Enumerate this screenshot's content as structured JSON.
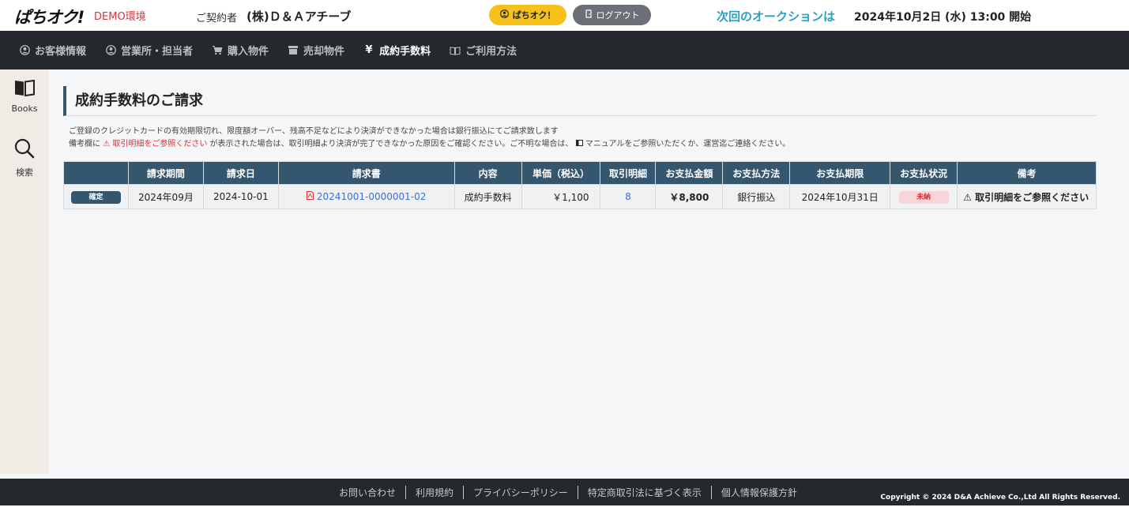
{
  "header": {
    "logo": "ぱちオク!",
    "environment": "DEMO環境",
    "contract_label": "ご契約者",
    "contract_name": "(株)Ｄ＆Ａアチーブ",
    "pachi_button": "ぱちオク！",
    "logout_button": "ログアウト",
    "next_auction_label": "次回のオークションは",
    "next_auction_date": "2024年10月2日 (水) 13:00 開始"
  },
  "nav": {
    "items": [
      {
        "label": "お客様情報",
        "icon": "user-circle-icon"
      },
      {
        "label": "営業所・担当者",
        "icon": "user-circle-icon"
      },
      {
        "label": "購入物件",
        "icon": "cart-icon"
      },
      {
        "label": "売却物件",
        "icon": "box-icon"
      },
      {
        "label": "成約手数料",
        "icon": "yen-icon"
      },
      {
        "label": "ご利用方法",
        "icon": "book-icon"
      }
    ]
  },
  "sidebar": {
    "books_label": "Books",
    "search_label": "検索"
  },
  "main": {
    "title": "成約手数料のご請求",
    "note1": "ご登録のクレジットカードの有効期限切れ、限度額オーバー、残高不足などにより決済ができなかった場合は銀行振込にてご請求致します",
    "note2_prefix": "備考欄に",
    "note2_warning": "取引明細をご参照ください",
    "note2_middle": "が表示された場合は、取引明細より決済が完了できなかった原因をご確認ください。ご不明な場合は、",
    "note2_suffix": "マニュアルをご参照いただくか、運営迄ご連絡ください。"
  },
  "table": {
    "headers": [
      "",
      "請求期間",
      "請求日",
      "請求書",
      "内容",
      "単価（税込）",
      "取引明細",
      "お支払金額",
      "お支払方法",
      "お支払期限",
      "お支払状況",
      "備考"
    ],
    "rows": [
      {
        "status_badge": "確定",
        "period": "2024年09月",
        "billing_date": "2024-10-01",
        "invoice": "20241001-0000001-02",
        "content": "成約手数料",
        "unit_price": "￥1,100",
        "details": "8",
        "amount": "￥8,800",
        "method": "銀行振込",
        "due": "2024年10月31日",
        "payment_status": "未納",
        "remark": "取引明細をご参照ください"
      }
    ]
  },
  "footer": {
    "links": [
      "お問い合わせ",
      "利用規約",
      "プライバシーポリシー",
      "特定商取引法に基づく表示",
      "個人情報保護方針"
    ],
    "copyright": "Copyright © 2024 D&A Achieve Co.,Ltd All Rights Reserved."
  },
  "colors": {
    "accent_dark": "#34566f",
    "nav_bg": "#25282c",
    "yellow": "#f6c21a",
    "red": "#d6323a",
    "link": "#3d6fd1",
    "teal": "#29a0c4"
  }
}
